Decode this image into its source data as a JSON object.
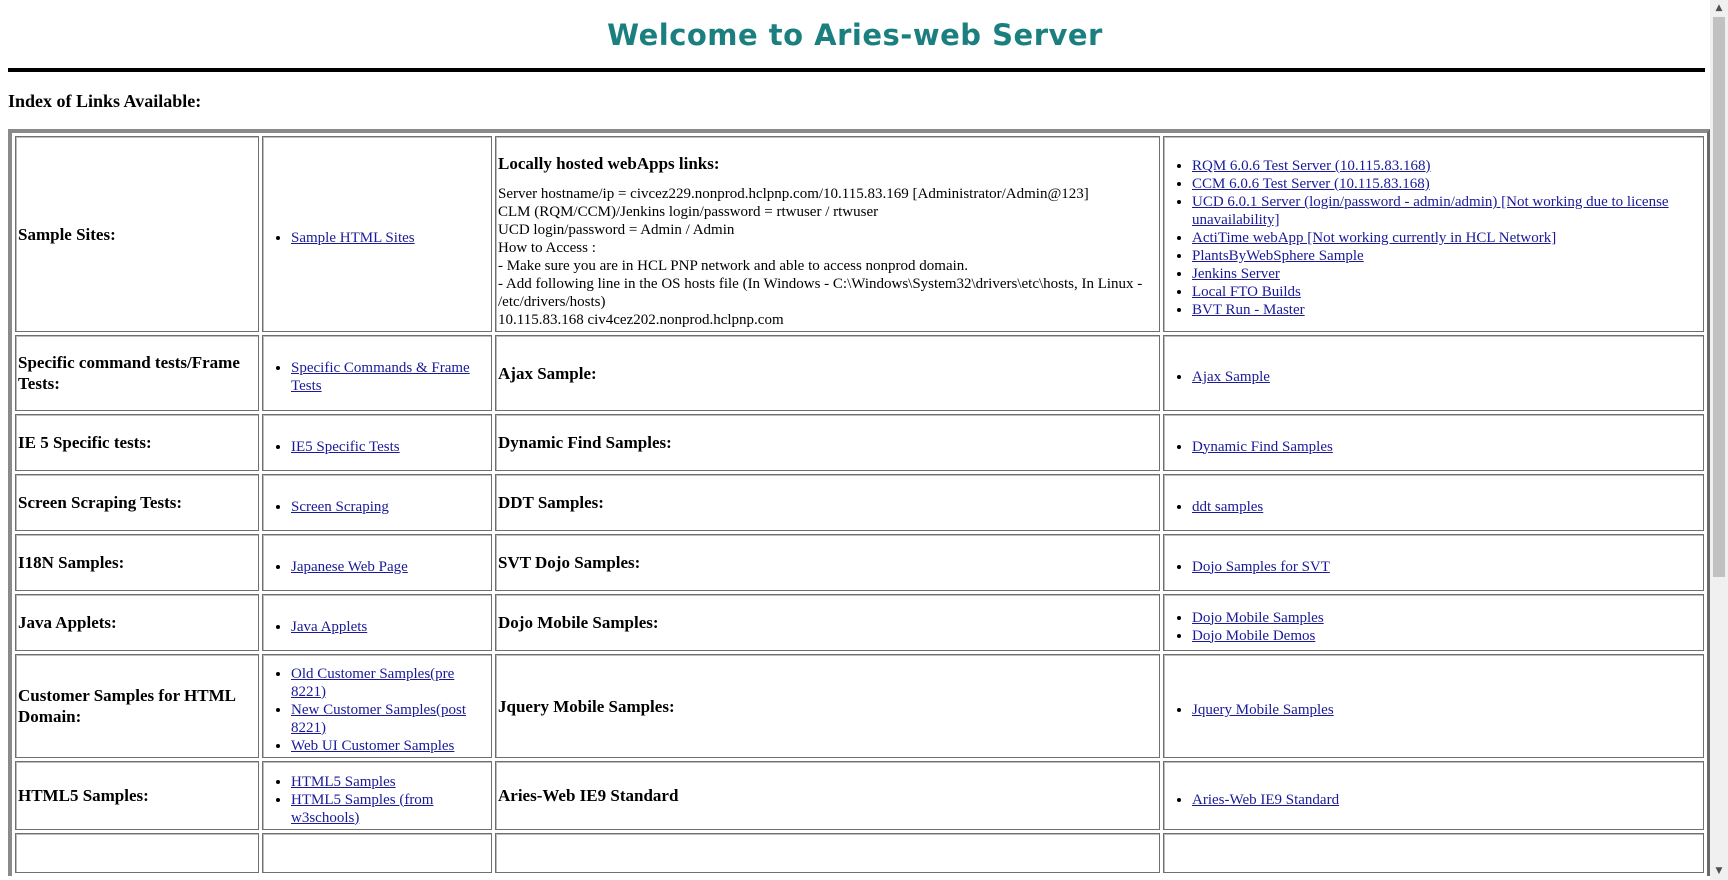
{
  "page": {
    "title": "Welcome to Aries-web Server",
    "index_heading": "Index of Links Available:"
  },
  "rows": [
    {
      "label": "Sample Sites:",
      "links1": [
        "Sample HTML Sites"
      ],
      "info": {
        "title": "Locally hosted webApps links:",
        "lines": [
          "Server hostname/ip = civcez229.nonprod.hclpnp.com/10.115.83.169 [Administrator/Admin@123]",
          "CLM (RQM/CCM)/Jenkins login/password = rtwuser / rtwuser",
          "UCD login/password = Admin / Admin",
          "How to Access :",
          "- Make sure you are in HCL PNP network and able to access nonprod domain.",
          "- Add following line in the OS hosts file (In Windows - C:\\Windows\\System32\\drivers\\etc\\hosts, In Linux - /etc/drivers/hosts)",
          "10.115.83.168 civ4cez202.nonprod.hclpnp.com"
        ]
      },
      "links2": [
        "RQM 6.0.6 Test Server (10.115.83.168)",
        "CCM 6.0.6 Test Server (10.115.83.168)",
        "UCD 6.0.1 Server (login/password - admin/admin) [Not working due to license unavailability]",
        "ActiTime webApp [Not working currently in HCL Network]",
        "PlantsByWebSphere Sample",
        "Jenkins Server",
        "Local FTO Builds",
        "BVT Run - Master"
      ]
    },
    {
      "label": "Specific command tests/Frame Tests:",
      "links1": [
        "Specific Commands & Frame Tests"
      ],
      "label2": "Ajax Sample:",
      "links2": [
        "Ajax Sample"
      ]
    },
    {
      "label": "IE 5 Specific tests:",
      "links1": [
        "IE5 Specific Tests"
      ],
      "label2": "Dynamic Find Samples:",
      "links2": [
        "Dynamic Find Samples"
      ]
    },
    {
      "label": "Screen Scraping Tests:",
      "links1": [
        "Screen Scraping"
      ],
      "label2": "DDT Samples:",
      "links2": [
        "ddt samples"
      ]
    },
    {
      "label": "I18N Samples:",
      "links1": [
        "Japanese Web Page"
      ],
      "label2": "SVT Dojo Samples:",
      "links2": [
        "Dojo Samples for SVT"
      ]
    },
    {
      "label": "Java Applets:",
      "links1": [
        "Java Applets"
      ],
      "label2": "Dojo Mobile Samples:",
      "links2": [
        "Dojo Mobile Samples",
        "Dojo Mobile Demos"
      ]
    },
    {
      "label": "Customer Samples for HTML Domain:",
      "links1": [
        "Old Customer Samples(pre 8221)",
        "New Customer Samples(post 8221)",
        "Web UI Customer Samples"
      ],
      "label2": "Jquery Mobile Samples:",
      "links2": [
        "Jquery Mobile Samples"
      ]
    },
    {
      "label": "HTML5 Samples:",
      "links1": [
        "HTML5 Samples",
        "HTML5 Samples (from w3schools)"
      ],
      "label2": "Aries-Web IE9 Standard",
      "links2": [
        "Aries-Web IE9 Standard"
      ]
    },
    {
      "label": "",
      "links1": [],
      "label2": "",
      "links2": []
    }
  ],
  "icons": {
    "scroll_up": "up-arrow-icon",
    "scroll_down": "down-arrow-icon"
  }
}
